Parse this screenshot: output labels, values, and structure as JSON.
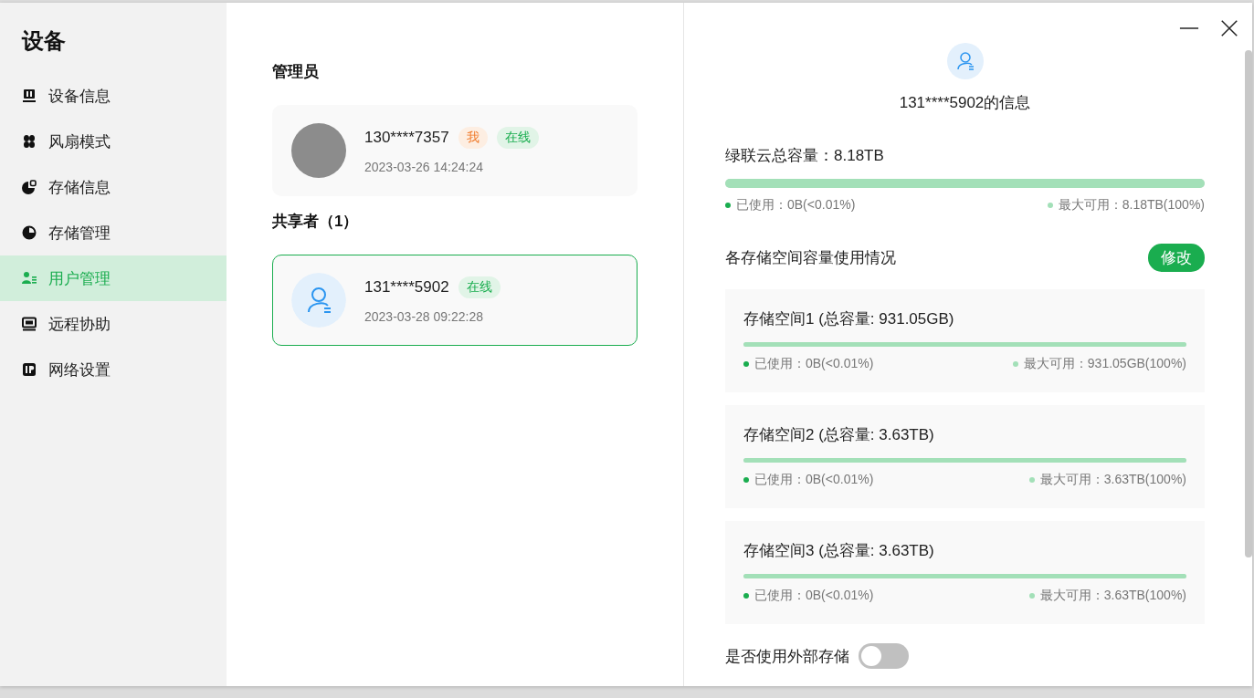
{
  "sidebar": {
    "title": "设备",
    "items": [
      {
        "label": "设备信息",
        "selected": false
      },
      {
        "label": "风扇模式",
        "selected": false
      },
      {
        "label": "存储信息",
        "selected": false
      },
      {
        "label": "存储管理",
        "selected": false
      },
      {
        "label": "用户管理",
        "selected": true
      },
      {
        "label": "远程协助",
        "selected": false
      },
      {
        "label": "网络设置",
        "selected": false
      }
    ]
  },
  "admins": {
    "heading": "管理员",
    "users": [
      {
        "name": "130****7357",
        "kind": "photo",
        "badges": [
          {
            "text": "我",
            "kind": "me"
          },
          {
            "text": "在线",
            "kind": "online"
          }
        ],
        "time": "2023-03-26 14:24:24",
        "selected": false
      }
    ]
  },
  "sharers": {
    "heading": "共享者（1）",
    "users": [
      {
        "name": "131****5902",
        "kind": "generic",
        "badges": [
          {
            "text": "在线",
            "kind": "online"
          }
        ],
        "time": "2023-03-28 09:22:28",
        "selected": true
      }
    ]
  },
  "detail": {
    "title": "131****5902的信息",
    "total": {
      "label": "绿联云总容量：8.18TB",
      "level": 1,
      "used": "已使用：0B(<0.01%)",
      "available": "最大可用：8.18TB(100%)"
    },
    "spaces_heading": "各存储空间容量使用情况",
    "edit_button": "修改",
    "spaces": [
      {
        "title": "存储空间1 (总容量: 931.05GB)",
        "level": 1,
        "used": "已使用：0B(<0.01%)",
        "available": "最大可用：931.05GB(100%)"
      },
      {
        "title": "存储空间2 (总容量: 3.63TB)",
        "level": 1,
        "used": "已使用：0B(<0.01%)",
        "available": "最大可用：3.63TB(100%)"
      },
      {
        "title": "存储空间3 (总容量: 3.63TB)",
        "level": 1,
        "used": "已使用：0B(<0.01%)",
        "available": "最大可用：3.63TB(100%)"
      }
    ],
    "external": {
      "label": "是否使用外部存储",
      "on": false
    }
  }
}
